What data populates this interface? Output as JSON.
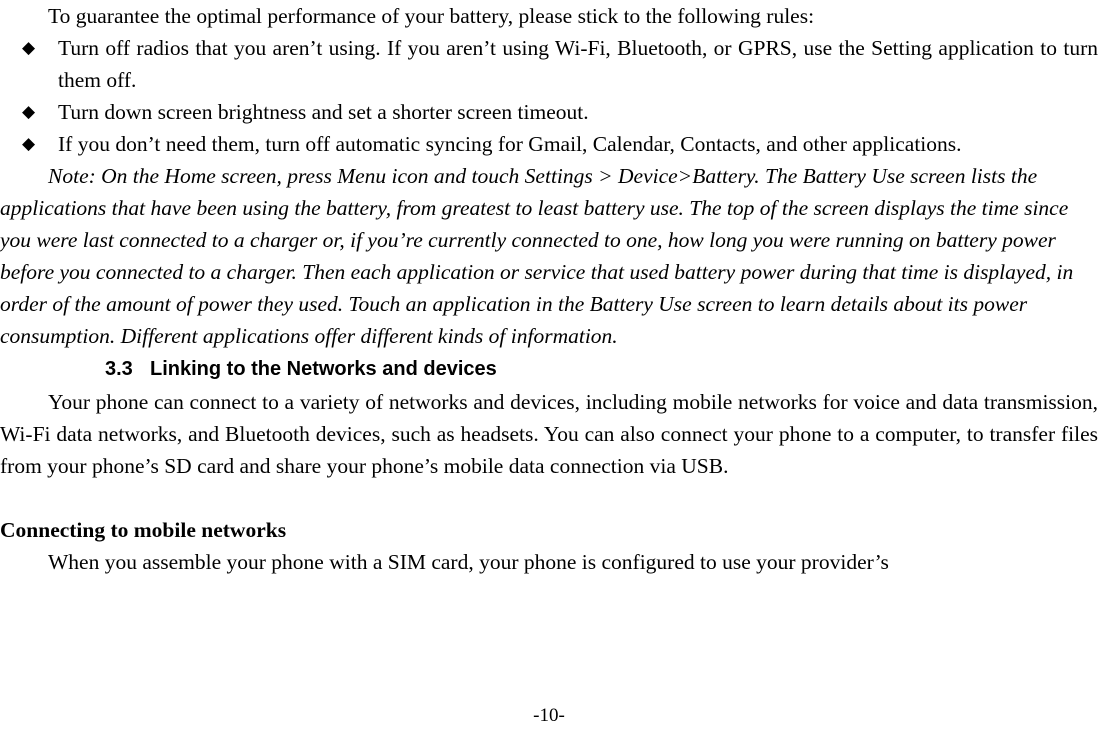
{
  "document": {
    "page_number_label": "-10-"
  },
  "battery_section": {
    "intro": "To guarantee the optimal performance of your battery, please stick to the following rules:",
    "bullet_marker": "◆",
    "bullets": [
      "Turn off radios that you aren’t using. If you aren’t using Wi-Fi, Bluetooth, or GPRS, use the Setting application to turn them off.",
      "Turn down screen brightness and set a shorter screen timeout.",
      "If you don’t need them, turn off automatic syncing for Gmail, Calendar, Contacts, and other applications."
    ],
    "note": "Note: On the Home screen, press Menu icon and touch Settings > Device>Battery. The Battery Use screen lists the applications that have been using the battery, from greatest to least battery use. The top of the screen displays the time since you were last connected to a charger or, if you’re currently connected to one, how long you were running on battery power before you connected to a charger. Then each application or service that used battery power during that time is displayed, in order of the amount of power they used. Touch an application in the Battery Use screen to learn details about its power consumption. Different applications offer different kinds of information."
  },
  "networks_section": {
    "number": "3.3",
    "title": "Linking to the Networks and devices",
    "intro_paragraph": "Your phone can connect to a variety of networks and devices, including mobile networks for voice and data transmission, Wi-Fi data networks, and Bluetooth devices, such as headsets. You can also connect your phone to a computer, to transfer files from your phone’s SD card and share your phone’s mobile data connection via USB.",
    "subsection": {
      "heading": "Connecting to mobile networks",
      "paragraph": "When you assemble your phone with a SIM card, your phone is configured to use your provider’s"
    }
  }
}
